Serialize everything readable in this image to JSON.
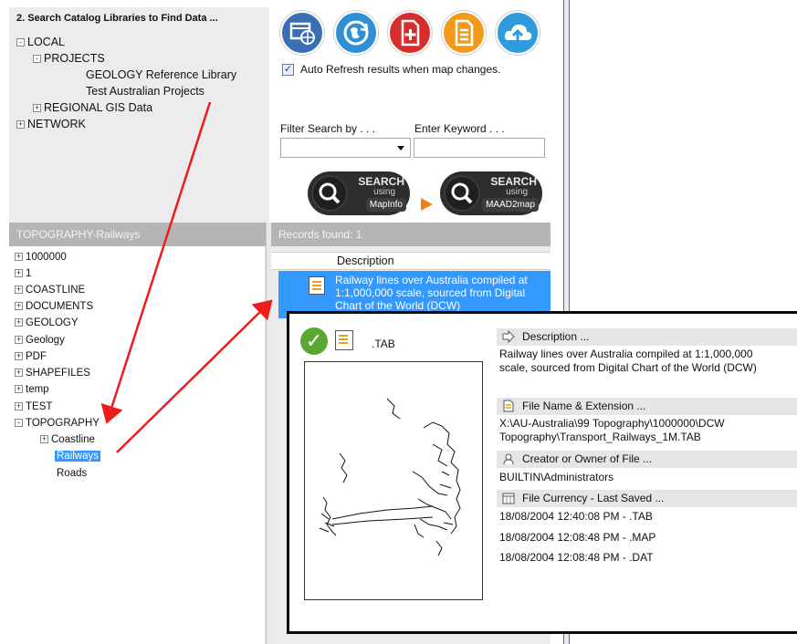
{
  "panel_title": "2. Search Catalog Libraries to Find Data ...",
  "library_tree": [
    {
      "label": "LOCAL",
      "expander": "-"
    },
    {
      "label": "PROJECTS",
      "expander": "-"
    },
    {
      "label": "GEOLOGY Reference Library",
      "expander": ""
    },
    {
      "label": "Test Australian Projects",
      "expander": ""
    },
    {
      "label": "REGIONAL GIS Data",
      "expander": "+"
    },
    {
      "label": "NETWORK",
      "expander": "+"
    }
  ],
  "toolbar_buttons": [
    {
      "name": "web-browser-icon",
      "color": "#3a6fb5"
    },
    {
      "name": "globe-refresh-icon",
      "color": "#2f8fd6"
    },
    {
      "name": "add-document-icon",
      "color": "#d72d2d"
    },
    {
      "name": "list-document-icon",
      "color": "#f29a1c"
    },
    {
      "name": "cloud-upload-icon",
      "color": "#2f9bdc"
    }
  ],
  "auto_refresh": {
    "label": "Auto Refresh results when map changes.",
    "checked": true,
    "mark": "✓"
  },
  "filter": {
    "label": "Filter Search by . . .",
    "value": ""
  },
  "keyword": {
    "label": "Enter Keyword . . .",
    "value": ""
  },
  "search_mapinfo": {
    "title": "SEARCH",
    "using": "using",
    "target": "MapInfo"
  },
  "search_maad2map": {
    "title": "SEARCH",
    "using": "using",
    "target": "MAAD2map"
  },
  "breadcrumb": "TOPOGRAPHY-Railways",
  "records_found": "Records found: 1",
  "folder_tree": [
    {
      "label": "1000000",
      "expander": "+"
    },
    {
      "label": "1",
      "expander": "+"
    },
    {
      "label": "COASTLINE",
      "expander": "+"
    },
    {
      "label": "DOCUMENTS",
      "expander": "+"
    },
    {
      "label": "GEOLOGY",
      "expander": "+"
    },
    {
      "label": "Geology",
      "expander": "+"
    },
    {
      "label": "PDF",
      "expander": "+"
    },
    {
      "label": "SHAPEFILES",
      "expander": "+"
    },
    {
      "label": "temp",
      "expander": "+"
    },
    {
      "label": "TEST",
      "expander": "+"
    },
    {
      "label": "TOPOGRAPHY",
      "expander": "-"
    },
    {
      "label": "Coastline",
      "expander": "+"
    },
    {
      "label": "Railways",
      "expander": "",
      "selected": true
    },
    {
      "label": "Roads",
      "expander": ""
    }
  ],
  "results": {
    "column_header": "Description",
    "rows": [
      {
        "description": "Railway lines over Australia compiled at 1:1,000,000 scale, sourced from Digital Chart of the World (DCW)"
      }
    ]
  },
  "details": {
    "file_type": ".TAB",
    "description_header": "Description ...",
    "description_lines": [
      "Railway lines over Australia compiled at 1:1,000,000",
      "scale, sourced from Digital Chart of the World (DCW)"
    ],
    "filename_header": "File Name & Extension ...",
    "filename_lines": [
      "X:\\AU-Australia\\99 Topography\\1000000\\DCW",
      "Topography\\Transport_Railways_1M.TAB"
    ],
    "creator_header": "Creator or Owner of File ...",
    "creator": "BUILTIN\\Administrators",
    "currency_header": "File Currency - Last Saved ...",
    "saved": [
      "18/08/2004 12:40:08 PM - .TAB",
      "18/08/2004 12:08:48 PM - .MAP",
      "18/08/2004 12:08:48 PM - .DAT"
    ]
  },
  "annotation_color": "#ee1c1c"
}
